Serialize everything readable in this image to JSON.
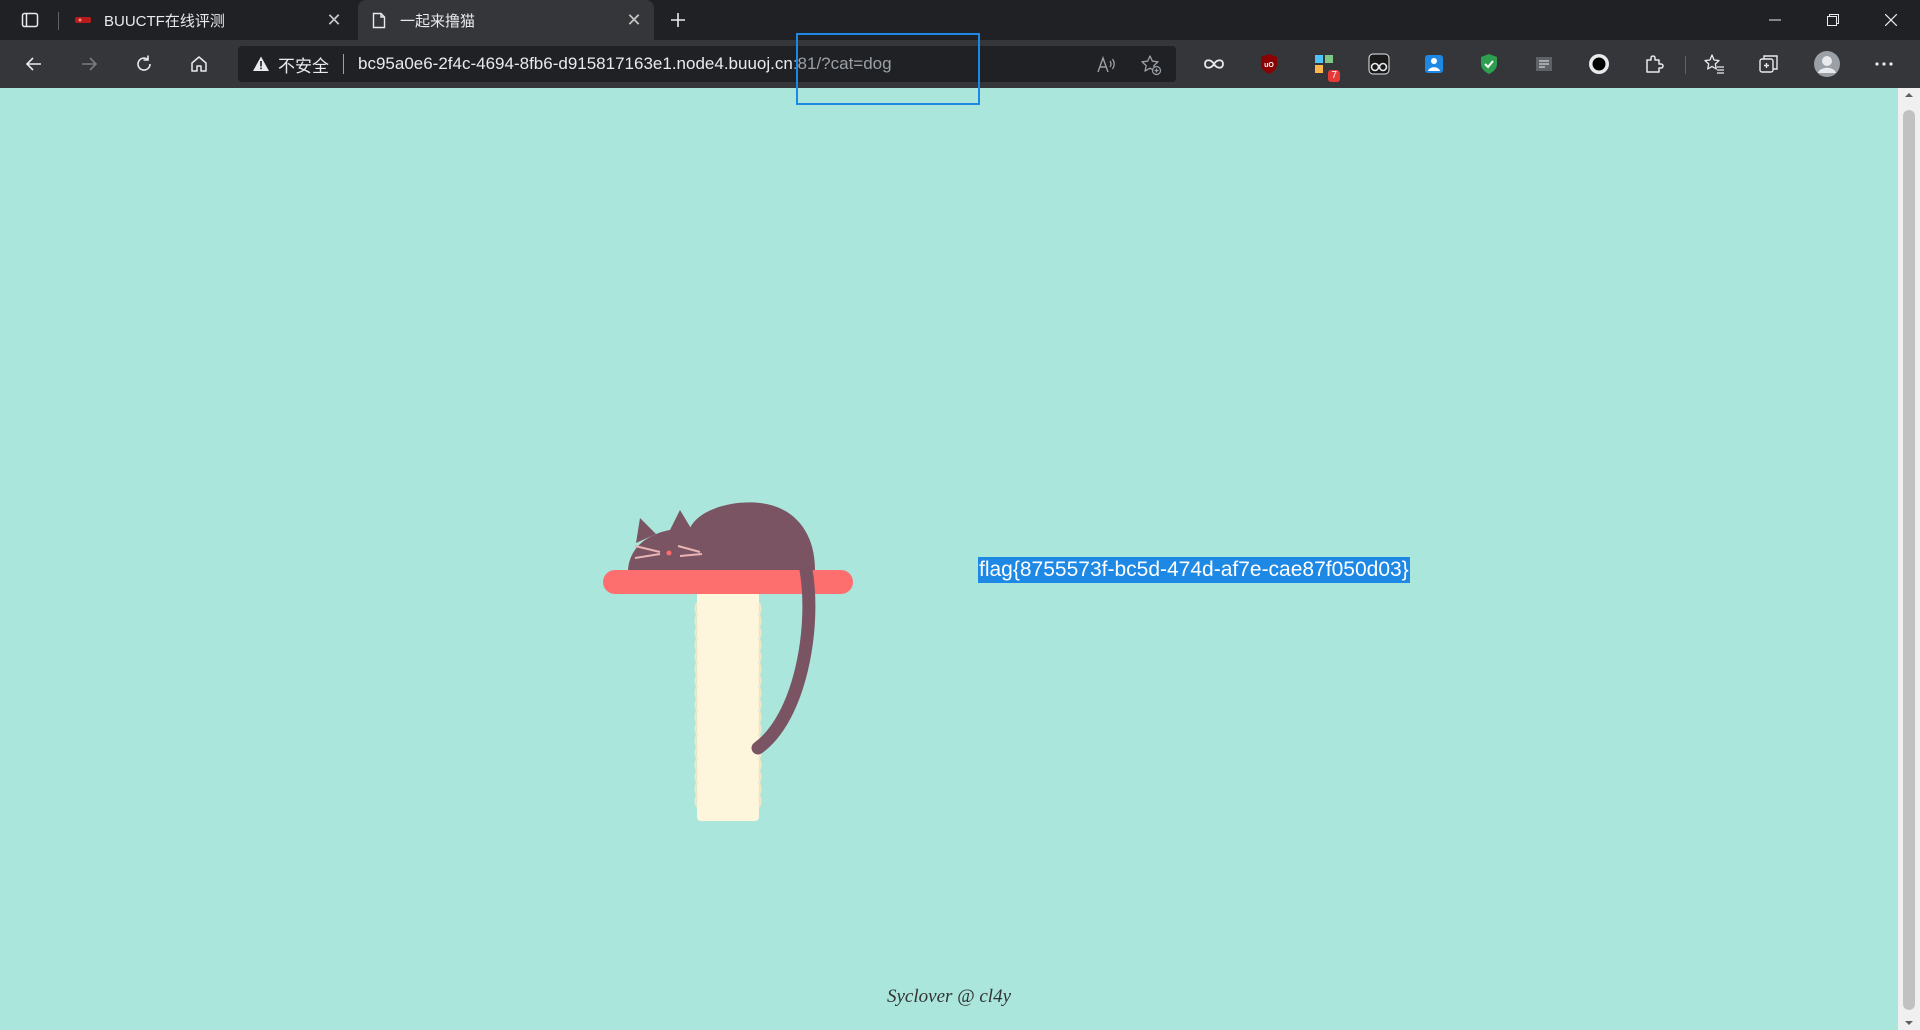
{
  "browser": {
    "tabs": [
      {
        "title": "BUUCTF在线评测",
        "favicon": "buuctf-icon",
        "active": false
      },
      {
        "title": "一起来撸猫",
        "favicon": "page-icon",
        "active": true
      }
    ],
    "address_bar": {
      "security_label": "不安全",
      "url_host": "bc95a0e6-2f4c-4694-8fb6-d915817163e1.node4.buuoj.cn",
      "url_rest": ":81/?cat=dog"
    },
    "extensions": [
      {
        "name": "infinity-extension-icon"
      },
      {
        "name": "ublock-origin-icon"
      },
      {
        "name": "extension-with-badge-icon",
        "badge": "7"
      },
      {
        "name": "tampermonkey-icon"
      },
      {
        "name": "blue-extension-icon"
      },
      {
        "name": "shield-extension-icon"
      },
      {
        "name": "reader-extension-icon"
      },
      {
        "name": "record-extension-icon"
      }
    ],
    "accent_color": "#1e88e5"
  },
  "page": {
    "background_color": "#aae6dc",
    "flag_text": "flag{8755573f-bc5d-474d-af7e-cae87f050d03}",
    "footer": "Syclover @ cl4y"
  }
}
